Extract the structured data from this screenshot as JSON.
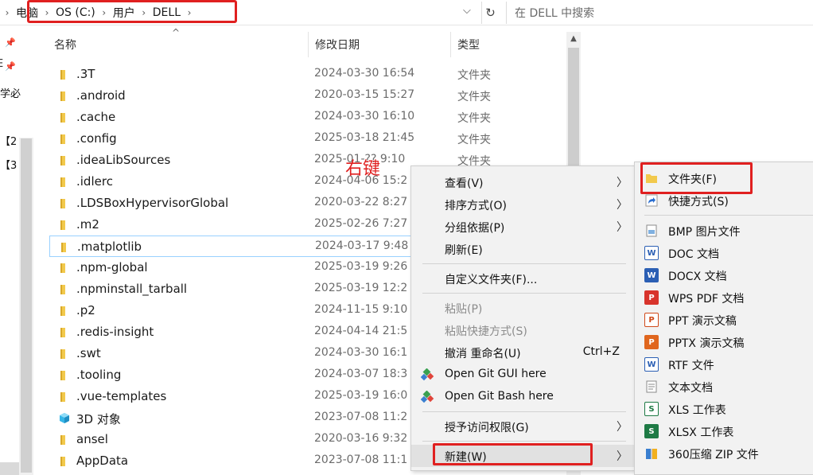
{
  "address_bar": {
    "crumbs": [
      "电脑",
      "OS (C:)",
      "用户",
      "DELL"
    ],
    "search_placeholder": "在 DELL 中搜索"
  },
  "nav_pane": {
    "partial_labels": [
      "学必",
      "【2",
      "【3"
    ],
    "partial_label_top": "E"
  },
  "columns": {
    "name": "名称",
    "date": "修改日期",
    "type": "类型"
  },
  "files": [
    {
      "name": ".3T",
      "date": "2024-03-30 16:54",
      "type": "文件夹",
      "icon": "folder-icon"
    },
    {
      "name": ".android",
      "date": "2020-03-15 15:27",
      "type": "文件夹",
      "icon": "folder-icon"
    },
    {
      "name": ".cache",
      "date": "2024-03-30 16:10",
      "type": "文件夹",
      "icon": "folder-icon"
    },
    {
      "name": ".config",
      "date": "2025-03-18 21:45",
      "type": "文件夹",
      "icon": "folder-icon"
    },
    {
      "name": ".ideaLibSources",
      "date": "2025-01-?? 9:10",
      "type": "文件夹",
      "icon": "folder-icon"
    },
    {
      "name": ".idlerc",
      "date": "2024-04-06 15:2",
      "type": "",
      "icon": "folder-icon"
    },
    {
      "name": ".LDSBoxHypervisorGlobal",
      "date": "2020-03-22 8:27",
      "type": "",
      "icon": "folder-icon"
    },
    {
      "name": ".m2",
      "date": "2025-02-26 7:27",
      "type": "",
      "icon": "folder-icon"
    },
    {
      "name": ".matplotlib",
      "date": "2024-03-17 9:48",
      "type": "",
      "icon": "folder-icon"
    },
    {
      "name": ".npm-global",
      "date": "2025-03-19 9:26",
      "type": "",
      "icon": "folder-icon"
    },
    {
      "name": ".npminstall_tarball",
      "date": "2025-03-19 12:2",
      "type": "",
      "icon": "folder-icon"
    },
    {
      "name": ".p2",
      "date": "2024-11-15 9:10",
      "type": "",
      "icon": "folder-icon"
    },
    {
      "name": ".redis-insight",
      "date": "2024-04-14 21:5",
      "type": "",
      "icon": "folder-icon"
    },
    {
      "name": ".swt",
      "date": "2024-03-30 16:1",
      "type": "",
      "icon": "folder-icon"
    },
    {
      "name": ".tooling",
      "date": "2024-03-07 18:3",
      "type": "",
      "icon": "folder-icon"
    },
    {
      "name": ".vue-templates",
      "date": "2025-03-19 16:0",
      "type": "",
      "icon": "folder-icon"
    },
    {
      "name": "3D 对象",
      "date": "2023-07-08 11:2",
      "type": "",
      "icon": "3d-objects-icon"
    },
    {
      "name": "ansel",
      "date": "2020-03-16 9:32",
      "type": "",
      "icon": "folder-icon"
    },
    {
      "name": "AppData",
      "date": "2023-07-08 11:1",
      "type": "",
      "icon": "folder-icon"
    }
  ],
  "annotation": "右键",
  "context_menu": {
    "items": [
      {
        "label": "查看(V)",
        "submenu": true,
        "disabled": false
      },
      {
        "label": "排序方式(O)",
        "submenu": true,
        "disabled": false
      },
      {
        "label": "分组依据(P)",
        "submenu": true,
        "disabled": false
      },
      {
        "label": "刷新(E)",
        "submenu": false,
        "disabled": false
      },
      {
        "label": "自定义文件夹(F)...",
        "submenu": false,
        "disabled": false
      },
      {
        "label": "粘贴(P)",
        "submenu": false,
        "disabled": true
      },
      {
        "label": "粘贴快捷方式(S)",
        "submenu": false,
        "disabled": true
      },
      {
        "label": "撤消 重命名(U)",
        "shortcut": "Ctrl+Z",
        "submenu": false,
        "disabled": false
      },
      {
        "label": "Open Git GUI here",
        "submenu": false,
        "disabled": false,
        "icon": "git-gui-icon"
      },
      {
        "label": "Open Git Bash here",
        "submenu": false,
        "disabled": false,
        "icon": "git-bash-icon"
      },
      {
        "label": "授予访问权限(G)",
        "submenu": true,
        "disabled": false
      },
      {
        "label": "新建(W)",
        "submenu": true,
        "disabled": false,
        "highlighted": true
      }
    ]
  },
  "new_submenu": {
    "items": [
      {
        "label": "文件夹(F)",
        "icon": "folder-icon",
        "badge": ""
      },
      {
        "label": "快捷方式(S)",
        "icon": "shortcut-icon",
        "badge": ""
      },
      {
        "label": "BMP 图片文件",
        "icon": "bmp-file-icon",
        "badge": ""
      },
      {
        "label": "DOC 文档",
        "icon": "doc-file-icon",
        "badge": "W"
      },
      {
        "label": "DOCX 文档",
        "icon": "docx-file-icon",
        "badge": "W"
      },
      {
        "label": "WPS PDF 文档",
        "icon": "wps-pdf-icon",
        "badge": "P"
      },
      {
        "label": "PPT 演示文稿",
        "icon": "ppt-file-icon",
        "badge": "P"
      },
      {
        "label": "PPTX 演示文稿",
        "icon": "pptx-file-icon",
        "badge": "P"
      },
      {
        "label": "RTF 文件",
        "icon": "rtf-file-icon",
        "badge": "W"
      },
      {
        "label": "文本文档",
        "icon": "text-file-icon",
        "badge": ""
      },
      {
        "label": "XLS 工作表",
        "icon": "xls-file-icon",
        "badge": "S"
      },
      {
        "label": "XLSX 工作表",
        "icon": "xlsx-file-icon",
        "badge": "S"
      },
      {
        "label": "360压缩 ZIP 文件",
        "icon": "zip-file-icon",
        "badge": ""
      }
    ]
  },
  "colors": {
    "highlight_red": "#e02020",
    "folder_yellow": "#f2c94c",
    "word_blue": "#2b5fb4",
    "excel_green": "#1e7a45",
    "ppt_orange": "#d04a1a"
  }
}
